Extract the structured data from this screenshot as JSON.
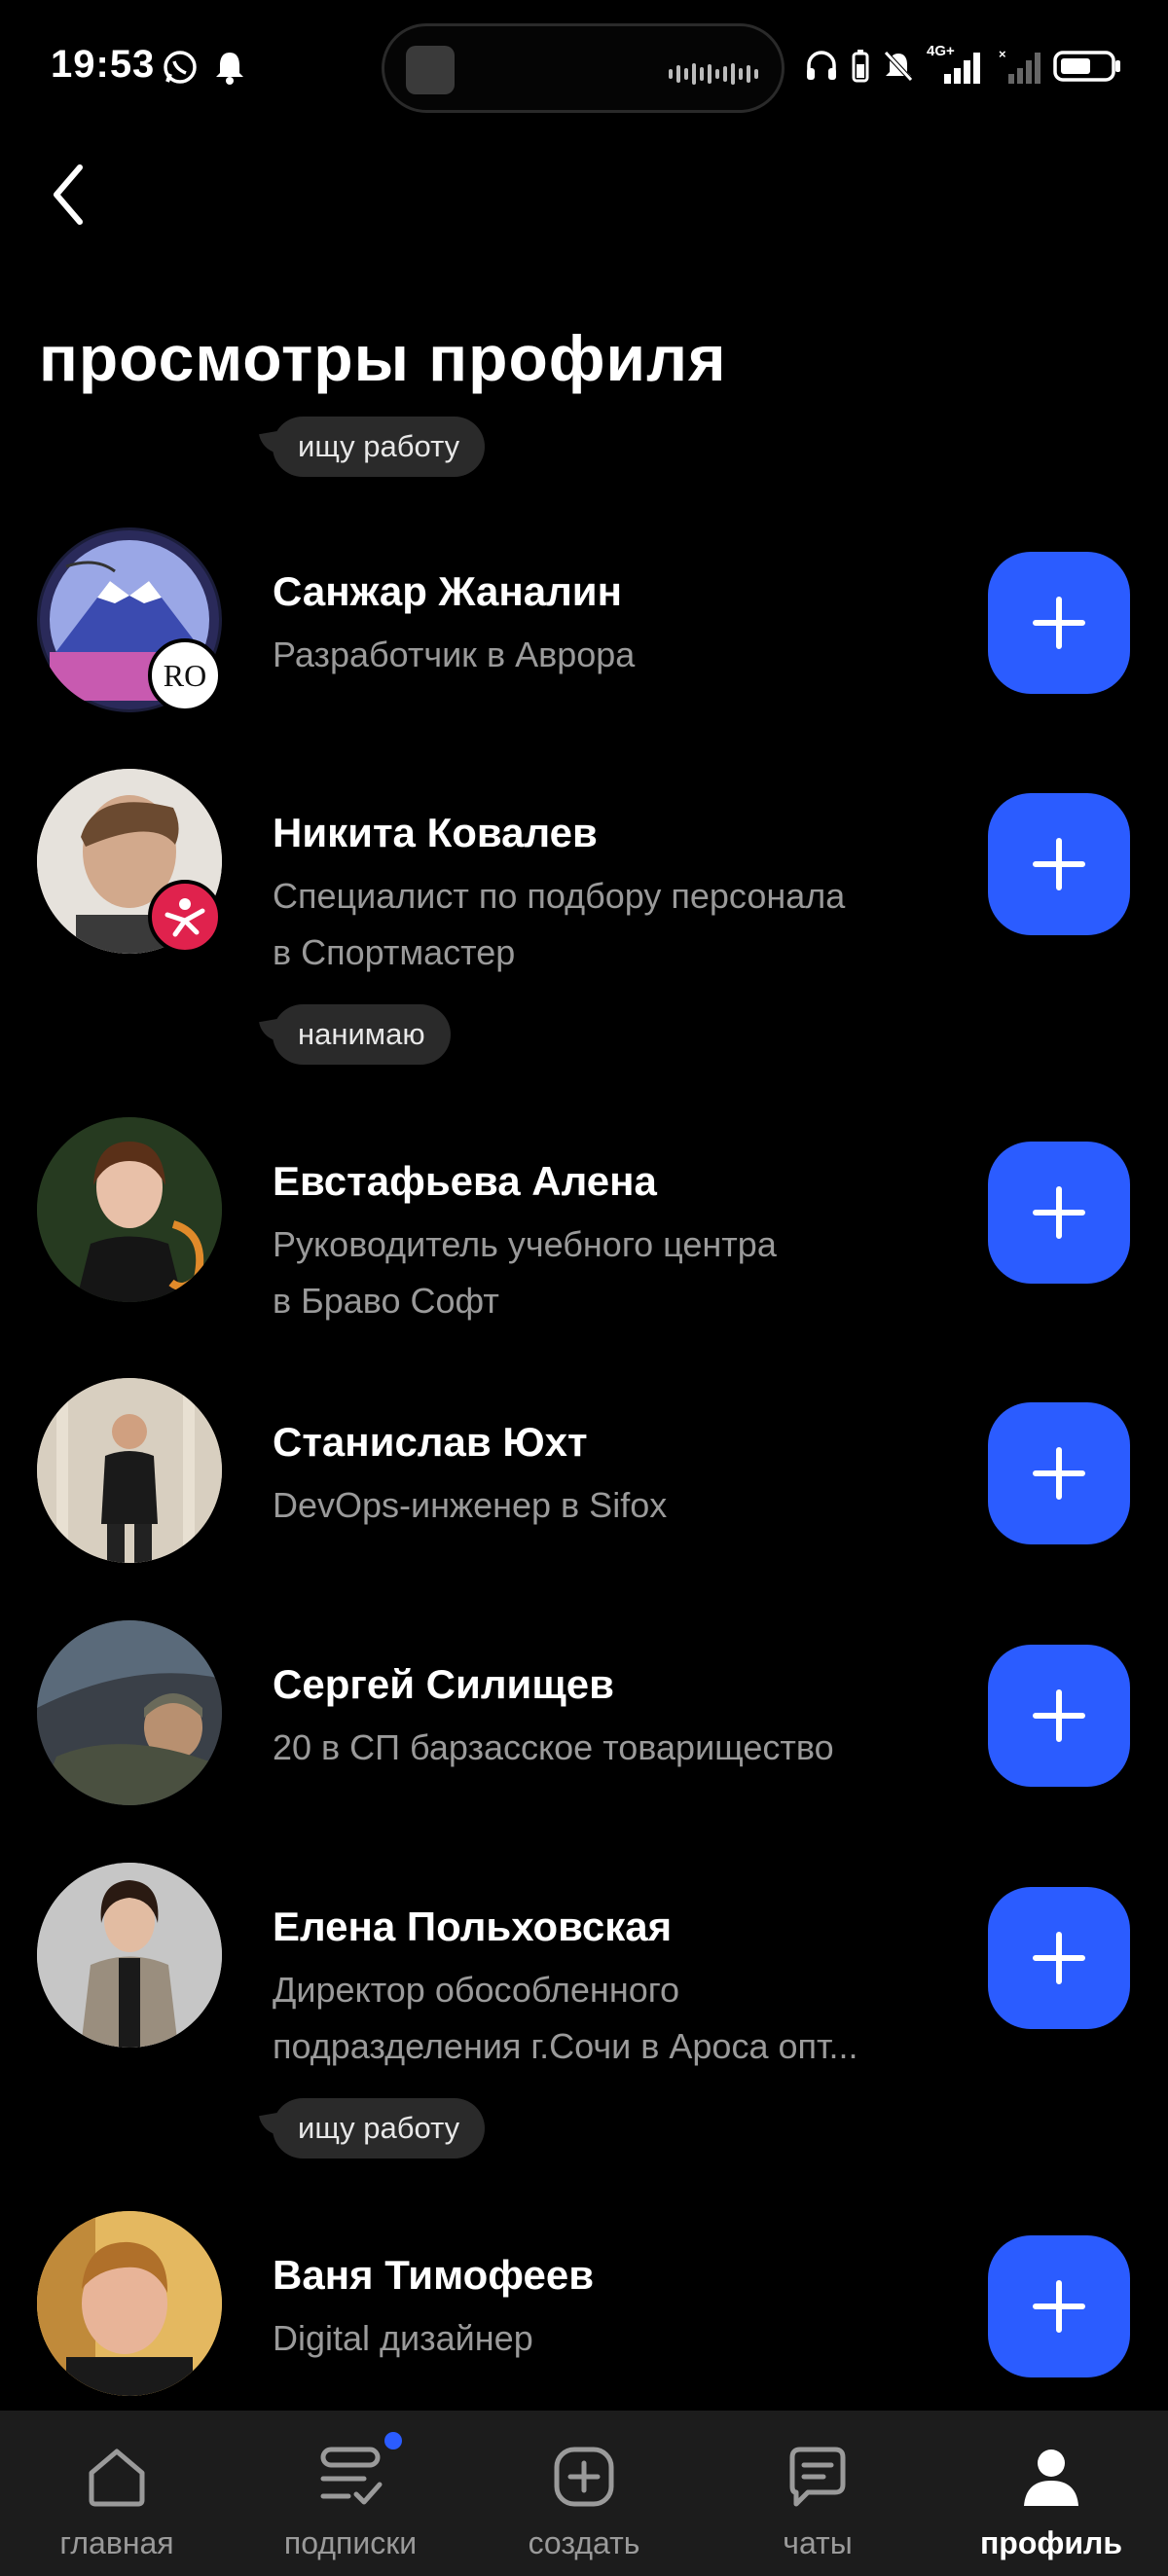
{
  "status_bar": {
    "time": "19:53",
    "network_label": "4G+"
  },
  "page": {
    "title": "просмотры профиля",
    "top_tag": "ищу работу"
  },
  "people": [
    {
      "name": "Санжар Жаналин",
      "subtitle_lines": [
        "Разработчик в Аврора"
      ],
      "badge_text": "RO",
      "tag": null
    },
    {
      "name": "Никита Ковалев",
      "subtitle_lines": [
        "Специалист по подбору персонала",
        "в Спортмастер"
      ],
      "tag": "нанимаю"
    },
    {
      "name": "Евстафьева Алена",
      "subtitle_lines": [
        "Руководитель учебного центра",
        "в Браво Софт"
      ],
      "tag": null
    },
    {
      "name": "Станислав Юхт",
      "subtitle_lines": [
        "DevOps-инженер в Sifox"
      ],
      "tag": null
    },
    {
      "name": "Сергей Силищев",
      "subtitle_lines": [
        "20 в СП барзасское товарищество"
      ],
      "tag": null
    },
    {
      "name": "Елена Польховская",
      "subtitle_lines": [
        "Директор обособленного",
        "подразделения г.Сочи в Ароса опт..."
      ],
      "tag": "ищу работу"
    },
    {
      "name": "Ваня Тимофеев",
      "subtitle_lines": [
        "Digital дизайнер"
      ],
      "tag": null
    }
  ],
  "add_button_icon": "plus-icon",
  "bottom_nav": [
    {
      "label": "главная",
      "icon": "home-icon",
      "active": false
    },
    {
      "label": "подписки",
      "icon": "subscriptions-icon",
      "active": false,
      "notification_dot": true
    },
    {
      "label": "создать",
      "icon": "create-icon",
      "active": false
    },
    {
      "label": "чаты",
      "icon": "chat-icon",
      "active": false
    },
    {
      "label": "профиль",
      "icon": "profile-icon",
      "active": true
    }
  ],
  "colors": {
    "background": "#000000",
    "accent": "#2b5cff",
    "tag_background": "#2a2a2a",
    "secondary_text": "#9a9a9a",
    "nav_background": "#1c1c1c"
  }
}
